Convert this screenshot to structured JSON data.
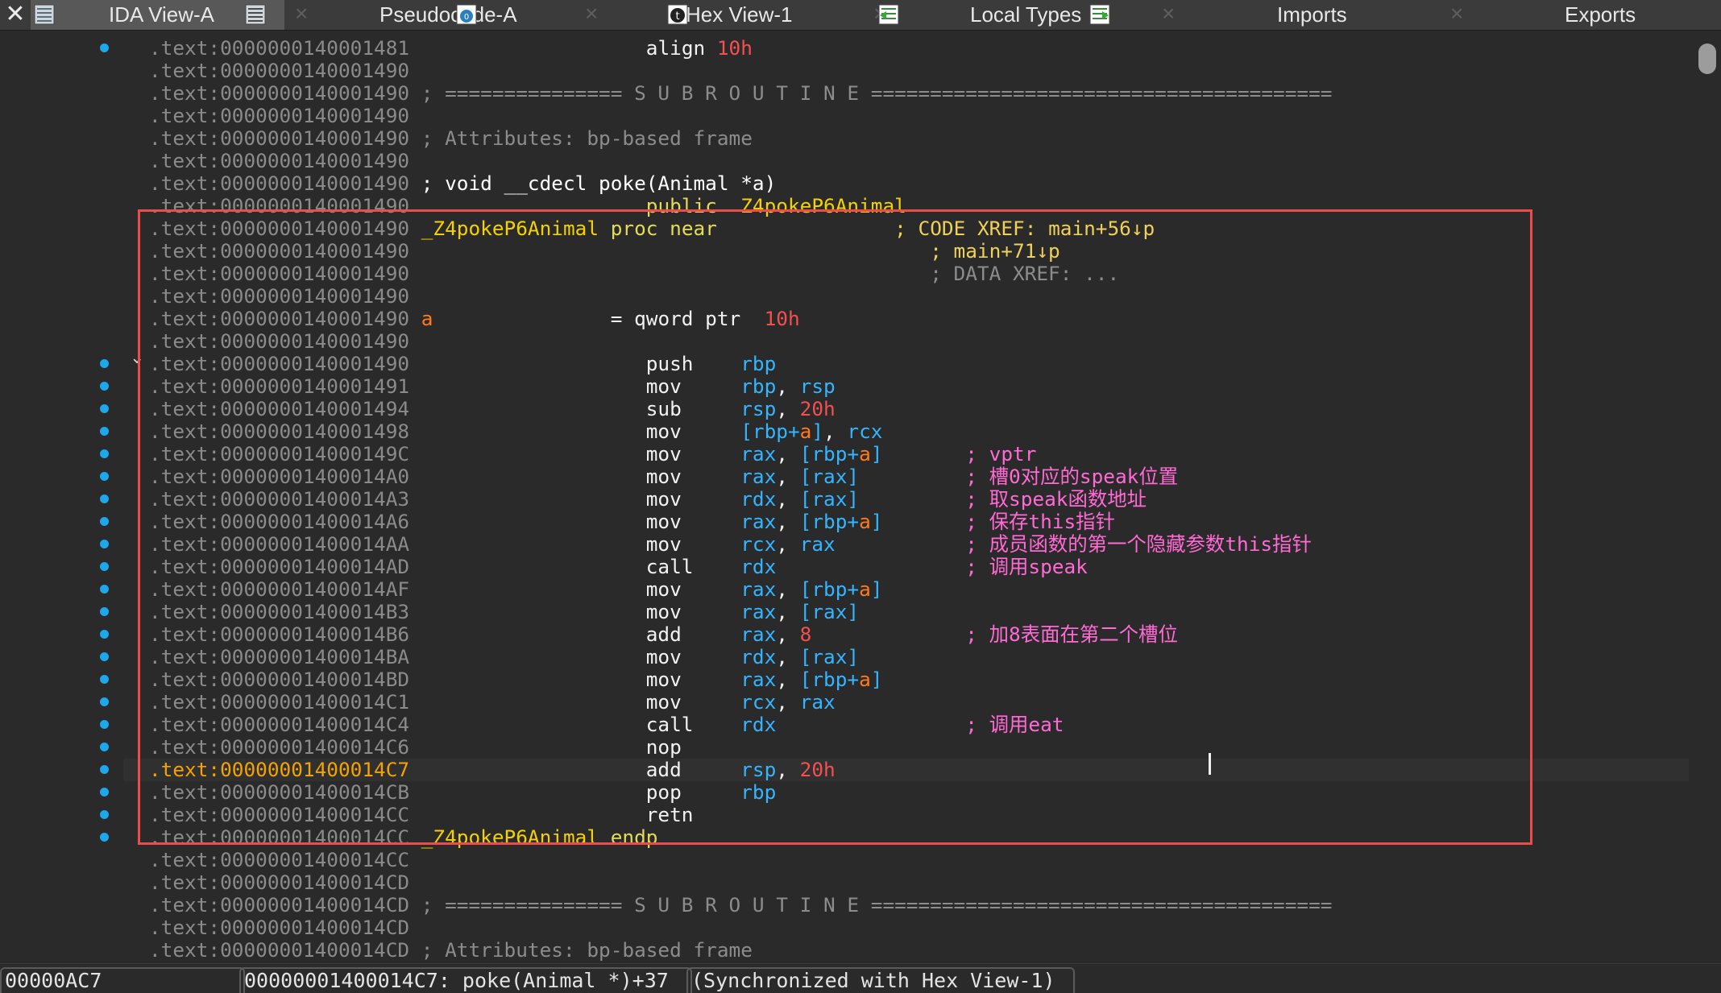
{
  "tabs": [
    {
      "label": "IDA View-A",
      "icon": "disassembly-view-icon",
      "active": true
    },
    {
      "label": "Pseudocode-A",
      "icon": "pseudocode-icon",
      "active": false
    },
    {
      "label": "Hex View-1",
      "icon": "hex-view-icon",
      "active": false
    },
    {
      "label": "Local Types",
      "icon": "local-types-icon",
      "active": false
    },
    {
      "label": "Imports",
      "icon": "imports-icon",
      "active": false
    },
    {
      "label": "Exports",
      "icon": "exports-icon",
      "active": false
    }
  ],
  "tab_close_glyph": "×",
  "window_close_glyph": "✕",
  "expand_glyph": "⌄",
  "colors": {
    "address": "#8b8b8b",
    "current_address": "#f4a300",
    "register": "#33b5ff",
    "immediate": "#f45050",
    "stack_var": "#ff7a1c",
    "user_comment": "#ff6ad5",
    "function_name": "#f4d200",
    "breakpoint_dot": "#1ea8ec",
    "selection_box": "#ee4b4b"
  },
  "listing": [
    {
      "addr": ".text:0000000140001481",
      "parts": [
        {
          "t": "                    ",
          "c": ""
        },
        {
          "t": "align ",
          "c": "c-mn"
        },
        {
          "t": "10h",
          "c": "c-num"
        }
      ]
    },
    {
      "addr": ".text:0000000140001490",
      "parts": []
    },
    {
      "addr": ".text:0000000140001490",
      "parts": [
        {
          "t": " ; =============== S U B R O U T I N E =======================================",
          "c": "c-cmt"
        }
      ]
    },
    {
      "addr": ".text:0000000140001490",
      "parts": []
    },
    {
      "addr": ".text:0000000140001490",
      "parts": [
        {
          "t": " ; Attributes: bp-based frame",
          "c": "c-cmt"
        }
      ]
    },
    {
      "addr": ".text:0000000140001490",
      "parts": []
    },
    {
      "addr": ".text:0000000140001490",
      "parts": [
        {
          "t": " ; void __cdecl poke(Animal *a)",
          "c": "c-user"
        }
      ]
    },
    {
      "addr": ".text:0000000140001490",
      "parts": [
        {
          "t": "                    ",
          "c": ""
        },
        {
          "t": "public  ",
          "c": "c-kw"
        },
        {
          "t": "Z4pokeP6Animal",
          "c": "c-name"
        }
      ]
    },
    {
      "addr": ".text:0000000140001490",
      "parts": [
        {
          "t": " ",
          "c": ""
        },
        {
          "t": "_Z4pokeP6Animal",
          "c": "c-name"
        },
        {
          "t": " proc near",
          "c": "c-kw"
        },
        {
          "t": "               ",
          "c": ""
        },
        {
          "t": "; CODE XREF: main+56↓p",
          "c": "c-xref"
        }
      ]
    },
    {
      "addr": ".text:0000000140001490",
      "parts": [
        {
          "t": "                                            ",
          "c": ""
        },
        {
          "t": "; main+71↓p",
          "c": "c-xref"
        }
      ]
    },
    {
      "addr": ".text:0000000140001490",
      "parts": [
        {
          "t": "                                            ",
          "c": ""
        },
        {
          "t": "; DATA XREF: ...",
          "c": "c-grey"
        }
      ]
    },
    {
      "addr": ".text:0000000140001490",
      "parts": []
    },
    {
      "addr": ".text:0000000140001490",
      "parts": [
        {
          "t": " ",
          "c": ""
        },
        {
          "t": "a",
          "c": "c-var"
        },
        {
          "t": "               = qword ptr  ",
          "c": "c-mn"
        },
        {
          "t": "10h",
          "c": "c-num"
        }
      ]
    },
    {
      "addr": ".text:0000000140001490",
      "parts": []
    },
    {
      "addr": ".text:0000000140001490",
      "parts": [
        {
          "t": "                    push    ",
          "c": "c-mn"
        },
        {
          "t": "rbp",
          "c": "c-reg"
        }
      ]
    },
    {
      "addr": ".text:0000000140001491",
      "parts": [
        {
          "t": "                    mov     ",
          "c": "c-mn"
        },
        {
          "t": "rbp",
          "c": "c-reg"
        },
        {
          "t": ", ",
          "c": "c-mn"
        },
        {
          "t": "rsp",
          "c": "c-reg"
        }
      ]
    },
    {
      "addr": ".text:0000000140001494",
      "parts": [
        {
          "t": "                    sub     ",
          "c": "c-mn"
        },
        {
          "t": "rsp",
          "c": "c-reg"
        },
        {
          "t": ", ",
          "c": "c-mn"
        },
        {
          "t": "20h",
          "c": "c-num"
        }
      ]
    },
    {
      "addr": ".text:0000000140001498",
      "parts": [
        {
          "t": "                    mov     ",
          "c": "c-mn"
        },
        {
          "t": "[rbp+",
          "c": "c-reg"
        },
        {
          "t": "a",
          "c": "c-var"
        },
        {
          "t": "]",
          "c": "c-reg"
        },
        {
          "t": ", ",
          "c": "c-mn"
        },
        {
          "t": "rcx",
          "c": "c-reg"
        }
      ]
    },
    {
      "addr": ".text:000000014000149C",
      "parts": [
        {
          "t": "                    mov     ",
          "c": "c-mn"
        },
        {
          "t": "rax",
          "c": "c-reg"
        },
        {
          "t": ", ",
          "c": "c-mn"
        },
        {
          "t": "[rbp+",
          "c": "c-reg"
        },
        {
          "t": "a",
          "c": "c-var"
        },
        {
          "t": "]",
          "c": "c-reg"
        },
        {
          "t": "       ",
          "c": ""
        },
        {
          "t": "; vptr",
          "c": "c-ucmt"
        }
      ]
    },
    {
      "addr": ".text:00000001400014A0",
      "parts": [
        {
          "t": "                    mov     ",
          "c": "c-mn"
        },
        {
          "t": "rax",
          "c": "c-reg"
        },
        {
          "t": ", ",
          "c": "c-mn"
        },
        {
          "t": "[rax]",
          "c": "c-reg"
        },
        {
          "t": "         ",
          "c": ""
        },
        {
          "t": "; 槽0对应的speak位置",
          "c": "c-ucmt"
        }
      ]
    },
    {
      "addr": ".text:00000001400014A3",
      "parts": [
        {
          "t": "                    mov     ",
          "c": "c-mn"
        },
        {
          "t": "rdx",
          "c": "c-reg"
        },
        {
          "t": ", ",
          "c": "c-mn"
        },
        {
          "t": "[rax]",
          "c": "c-reg"
        },
        {
          "t": "         ",
          "c": ""
        },
        {
          "t": "; 取speak函数地址",
          "c": "c-ucmt"
        }
      ]
    },
    {
      "addr": ".text:00000001400014A6",
      "parts": [
        {
          "t": "                    mov     ",
          "c": "c-mn"
        },
        {
          "t": "rax",
          "c": "c-reg"
        },
        {
          "t": ", ",
          "c": "c-mn"
        },
        {
          "t": "[rbp+",
          "c": "c-reg"
        },
        {
          "t": "a",
          "c": "c-var"
        },
        {
          "t": "]",
          "c": "c-reg"
        },
        {
          "t": "       ",
          "c": ""
        },
        {
          "t": "; 保存this指针",
          "c": "c-ucmt"
        }
      ]
    },
    {
      "addr": ".text:00000001400014AA",
      "parts": [
        {
          "t": "                    mov     ",
          "c": "c-mn"
        },
        {
          "t": "rcx",
          "c": "c-reg"
        },
        {
          "t": ", ",
          "c": "c-mn"
        },
        {
          "t": "rax",
          "c": "c-reg"
        },
        {
          "t": "           ",
          "c": ""
        },
        {
          "t": "; 成员函数的第一个隐藏参数this指针",
          "c": "c-ucmt"
        }
      ]
    },
    {
      "addr": ".text:00000001400014AD",
      "parts": [
        {
          "t": "                    call    ",
          "c": "c-mn"
        },
        {
          "t": "rdx",
          "c": "c-reg"
        },
        {
          "t": "                ",
          "c": ""
        },
        {
          "t": "; 调用speak",
          "c": "c-ucmt"
        }
      ]
    },
    {
      "addr": ".text:00000001400014AF",
      "parts": [
        {
          "t": "                    mov     ",
          "c": "c-mn"
        },
        {
          "t": "rax",
          "c": "c-reg"
        },
        {
          "t": ", ",
          "c": "c-mn"
        },
        {
          "t": "[rbp+",
          "c": "c-reg"
        },
        {
          "t": "a",
          "c": "c-var"
        },
        {
          "t": "]",
          "c": "c-reg"
        }
      ]
    },
    {
      "addr": ".text:00000001400014B3",
      "parts": [
        {
          "t": "                    mov     ",
          "c": "c-mn"
        },
        {
          "t": "rax",
          "c": "c-reg"
        },
        {
          "t": ", ",
          "c": "c-mn"
        },
        {
          "t": "[rax]",
          "c": "c-reg"
        }
      ]
    },
    {
      "addr": ".text:00000001400014B6",
      "parts": [
        {
          "t": "                    add     ",
          "c": "c-mn"
        },
        {
          "t": "rax",
          "c": "c-reg"
        },
        {
          "t": ", ",
          "c": "c-mn"
        },
        {
          "t": "8",
          "c": "c-num"
        },
        {
          "t": "             ",
          "c": ""
        },
        {
          "t": "; 加8表面在第二个槽位",
          "c": "c-ucmt"
        }
      ]
    },
    {
      "addr": ".text:00000001400014BA",
      "parts": [
        {
          "t": "                    mov     ",
          "c": "c-mn"
        },
        {
          "t": "rdx",
          "c": "c-reg"
        },
        {
          "t": ", ",
          "c": "c-mn"
        },
        {
          "t": "[rax]",
          "c": "c-reg"
        }
      ]
    },
    {
      "addr": ".text:00000001400014BD",
      "parts": [
        {
          "t": "                    mov     ",
          "c": "c-mn"
        },
        {
          "t": "rax",
          "c": "c-reg"
        },
        {
          "t": ", ",
          "c": "c-mn"
        },
        {
          "t": "[rbp+",
          "c": "c-reg"
        },
        {
          "t": "a",
          "c": "c-var"
        },
        {
          "t": "]",
          "c": "c-reg"
        }
      ]
    },
    {
      "addr": ".text:00000001400014C1",
      "parts": [
        {
          "t": "                    mov     ",
          "c": "c-mn"
        },
        {
          "t": "rcx",
          "c": "c-reg"
        },
        {
          "t": ", ",
          "c": "c-mn"
        },
        {
          "t": "rax",
          "c": "c-reg"
        }
      ]
    },
    {
      "addr": ".text:00000001400014C4",
      "parts": [
        {
          "t": "                    call    ",
          "c": "c-mn"
        },
        {
          "t": "rdx",
          "c": "c-reg"
        },
        {
          "t": "                ",
          "c": ""
        },
        {
          "t": "; 调用eat",
          "c": "c-ucmt"
        }
      ]
    },
    {
      "addr": ".text:00000001400014C6",
      "parts": [
        {
          "t": "                    nop",
          "c": "c-mn"
        }
      ]
    },
    {
      "addr": ".text:00000001400014C7",
      "current": true,
      "parts": [
        {
          "t": "                    add     ",
          "c": "c-mn"
        },
        {
          "t": "rsp",
          "c": "c-reg"
        },
        {
          "t": ", ",
          "c": "c-mn"
        },
        {
          "t": "20h",
          "c": "c-num"
        }
      ]
    },
    {
      "addr": ".text:00000001400014CB",
      "parts": [
        {
          "t": "                    pop     ",
          "c": "c-mn"
        },
        {
          "t": "rbp",
          "c": "c-reg"
        }
      ]
    },
    {
      "addr": ".text:00000001400014CC",
      "parts": [
        {
          "t": "                    retn",
          "c": "c-mn"
        }
      ]
    },
    {
      "addr": ".text:00000001400014CC",
      "parts": [
        {
          "t": " ",
          "c": ""
        },
        {
          "t": "_Z4pokeP6Animal",
          "c": "c-name"
        },
        {
          "t": " endp",
          "c": "c-kw"
        }
      ]
    },
    {
      "addr": ".text:00000001400014CC",
      "parts": []
    },
    {
      "addr": ".text:00000001400014CD",
      "parts": []
    },
    {
      "addr": ".text:00000001400014CD",
      "parts": [
        {
          "t": " ; =============== S U B R O U T I N E =======================================",
          "c": "c-cmt"
        }
      ]
    },
    {
      "addr": ".text:00000001400014CD",
      "parts": []
    },
    {
      "addr": ".text:00000001400014CD",
      "parts": [
        {
          "t": " ; Attributes: bp-based frame",
          "c": "c-cmt"
        }
      ]
    },
    {
      "addr": ".text:00000001400014CD",
      "parts": []
    }
  ],
  "status": {
    "file_offset": "00000AC7",
    "location": "00000001400014C7: poke(Animal *)+37",
    "sync": "(Synchronized with Hex View-1)"
  }
}
